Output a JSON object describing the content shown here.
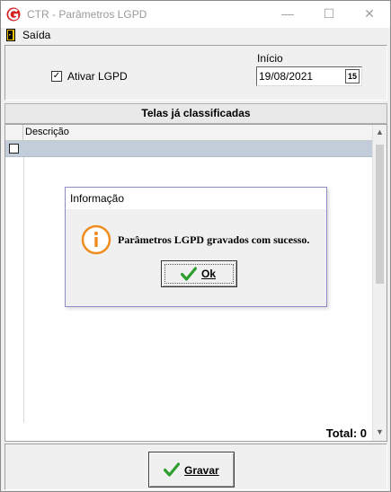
{
  "window": {
    "title": "CTR - Parâmetros LGPD",
    "logo_icon": "ctr-logo-icon",
    "controls": {
      "minimize": "—",
      "maximize": "☐",
      "close": "✕"
    }
  },
  "menu": {
    "items": [
      {
        "label": "Saída",
        "icon": "exit-door-icon"
      }
    ]
  },
  "settings": {
    "ativar_lgpd_label": "Ativar LGPD",
    "ativar_lgpd_checked": true,
    "inicio_label": "Início",
    "inicio_value": "19/08/2021",
    "calendar_icon_text": "15"
  },
  "grid": {
    "section_title": "Telas já classificadas",
    "columns": [
      "Descrição"
    ],
    "rows": [
      {
        "checked": false,
        "descricao": ""
      }
    ],
    "total_text": "Total: 0"
  },
  "actions": {
    "gravar_label": "Gravar"
  },
  "dialog": {
    "title": "Informação",
    "message": "Parâmetros LGPD gravados com sucesso.",
    "ok_label": "Ok",
    "icon": "info-icon"
  },
  "colors": {
    "selected_row": "#c2cdd9",
    "info_orange": "#f08c1e",
    "check_green": "#2e9e2e",
    "logo_red": "#d42020"
  }
}
